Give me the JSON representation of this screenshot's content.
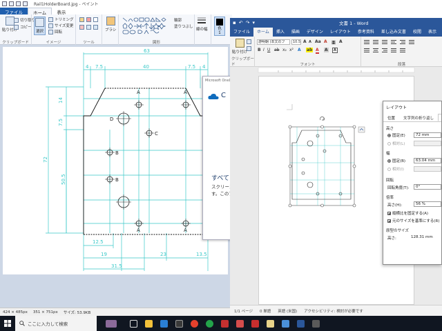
{
  "paint": {
    "title": "Rail1HolderBoard.jpg - ペイント",
    "tabs": [
      "ファイル",
      "ホーム",
      "表示"
    ],
    "clipboard": {
      "paste": "貼り付け",
      "cut": "切り取り",
      "copy": "コピー",
      "label": "クリップボード"
    },
    "image": {
      "select": "選択",
      "crop": "トリミング",
      "resize": "サイズ変更",
      "rotate": "回転",
      "label": "イメージ"
    },
    "tools": {
      "label": "ツール"
    },
    "brush": "ブラシ",
    "shapes": {
      "outline": "輪郭",
      "fill": "塗りつぶし",
      "label": "図形"
    },
    "linewidth": "線の幅",
    "color1": "色\n1",
    "status": {
      "pos": "424 × 485px",
      "size": "351 × 751px",
      "filesize": "サイズ: 53.9KB"
    }
  },
  "drawing": {
    "dims": {
      "top_overall": "63",
      "top_4a": "4",
      "top_75a": "7.5",
      "top_40": "40",
      "top_75b": "7.5",
      "top_4b": "4",
      "left_14": "14",
      "left_75": "7.5",
      "left_72": "72",
      "left_505": "50.5",
      "bot_125": "12.5",
      "bot_19": "19",
      "bot_23": "23",
      "bot_135": "13.5",
      "bot_315": "31.5"
    },
    "labels": {
      "a": "A",
      "b": "B",
      "c": "C",
      "d": "D"
    }
  },
  "onedrive": {
    "header": "Microsoft OneDrive",
    "cloud_letter": "C",
    "heading": "すべて",
    "body1": "スクリーン",
    "body2": "す。このア"
  },
  "word": {
    "title": "文書 1  -  Word",
    "tabs": [
      "ファイル",
      "ホーム",
      "挿入",
      "描画",
      "デザイン",
      "レイアウト",
      "参考資料",
      "差し込み文書",
      "校閲",
      "表示",
      "ヘ"
    ],
    "paste": "貼り付け",
    "clipboard_label": "クリップボード",
    "font_name": "游明朝 (本文のフ",
    "font_size": "10.5",
    "font_label": "フォント",
    "para_label": "段落",
    "status": {
      "page": "1/1 ページ",
      "words": "0 単語",
      "lang": "英語 (米国)",
      "access": "アクセシビリティ: 検討が必要です"
    }
  },
  "layout_dialog": {
    "title": "レイアウト",
    "tabs": [
      "位置",
      "文字列の折り返し",
      "サ"
    ],
    "height_section": "高さ",
    "height_fixed": "固定(E)",
    "height_fixed_value": "72 mm",
    "height_rel": "相対(L)",
    "width_section": "幅",
    "width_fixed": "固定(B)",
    "width_fixed_value": "63.04 mm",
    "width_rel": "相対(I)",
    "rotate_section": "回転",
    "rotate_label": "回転角度(T):",
    "rotate_value": "0°",
    "scale_section": "倍率",
    "scale_height_label": "高さ(H):",
    "scale_height_value": "56 %",
    "lock_aspect": "縦横比を固定する(A)",
    "relative_orig": "元のサイズを基準にする(R)",
    "orig_section": "原型のサイズ",
    "orig_height_label": "高さ:",
    "orig_height_value": "128.31 mm"
  },
  "taskbar": {
    "search_placeholder": "ここに入力して検索"
  },
  "colors": {
    "paint_accent": "#1f5fae",
    "word_accent": "#2b579a",
    "drawing_line": "#38c8c8",
    "taskbar": "#101621"
  }
}
